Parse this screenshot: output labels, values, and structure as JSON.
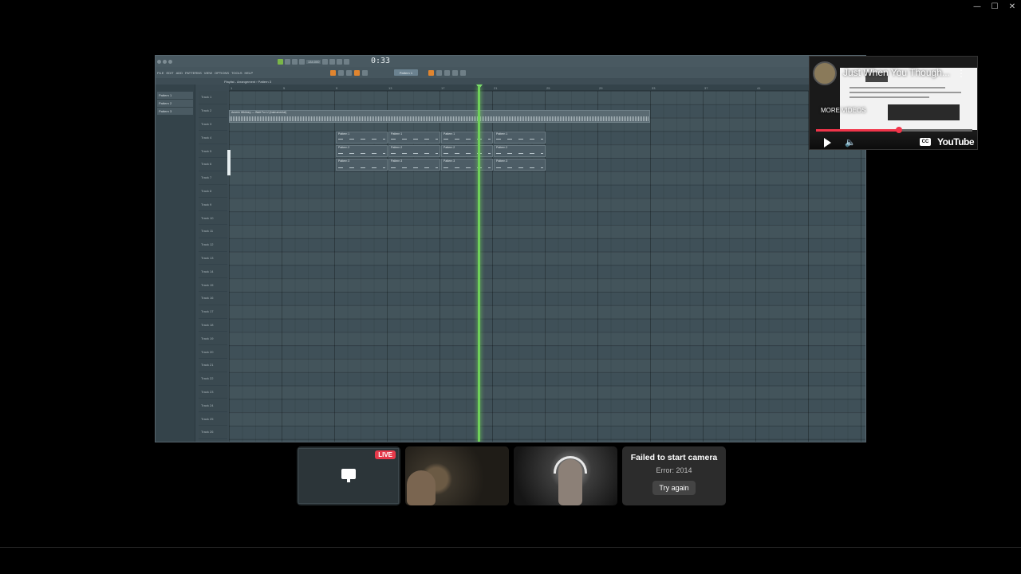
{
  "window": {
    "controls": [
      "—",
      "☐",
      "✕"
    ]
  },
  "fl_studio": {
    "song_time": "0:33",
    "tempo": "134.000",
    "menu": [
      "FILE",
      "EDIT",
      "ADD",
      "PATTERNS",
      "VIEW",
      "OPTIONS",
      "TOOLS",
      "HELP"
    ],
    "pattern_selector": "Pattern 1",
    "breadcrumb": "Playlist - Arrangement › Pattern 3",
    "patterns": [
      "Pattern 1",
      "Pattern 2",
      "Pattern 3"
    ],
    "tracks": [
      "Track 1",
      "Track 2",
      "Track 3",
      "Track 4",
      "Track 5",
      "Track 6",
      "Track 7",
      "Track 8",
      "Track 9",
      "Track 10",
      "Track 11",
      "Track 12",
      "Track 13",
      "Track 14",
      "Track 15",
      "Track 16",
      "Track 17",
      "Track 18",
      "Track 19",
      "Track 20",
      "Track 21",
      "Track 22",
      "Track 23",
      "Track 24",
      "Track 25",
      "Track 26"
    ],
    "ruler_ticks": [
      "1",
      "5",
      "9",
      "13",
      "17",
      "21",
      "25",
      "29",
      "33",
      "37",
      "41",
      "45"
    ],
    "audio_clip_label": "Amerix Whitney — Wait For U (Instrumental)",
    "pattern_clips": [
      {
        "label": "Pattern 1",
        "row": 3
      },
      {
        "label": "Pattern 2",
        "row": 4
      },
      {
        "label": "Pattern 3",
        "row": 5
      }
    ]
  },
  "youtube": {
    "title": "Just When You Though...",
    "more_videos": "MORE VIDEOS",
    "cc": "CC",
    "logo": "YouTube",
    "progress": 0.53
  },
  "participants": {
    "screen_share_live": "LIVE",
    "camera_error_title": "Failed to start camera",
    "camera_error_code": "Error: 2014",
    "retry_button": "Try again"
  }
}
